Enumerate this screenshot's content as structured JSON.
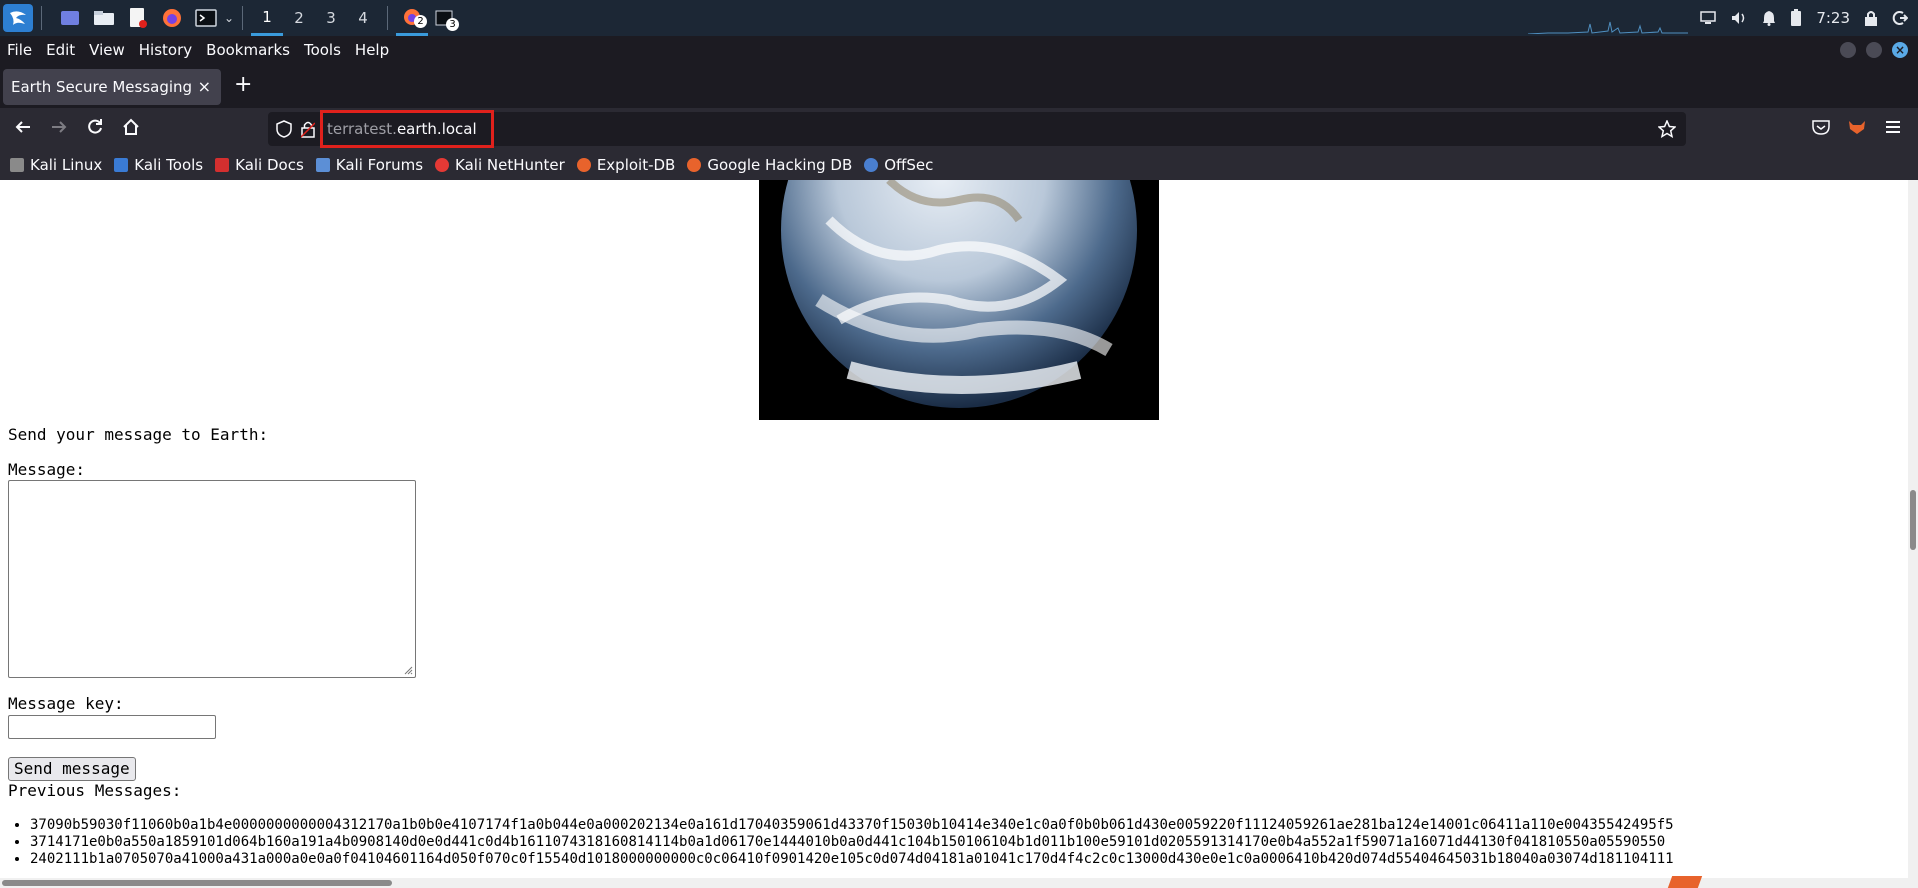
{
  "panel": {
    "workspaces": [
      "1",
      "2",
      "3",
      "4"
    ],
    "active_workspace": "1",
    "firefox_badge": "2",
    "terminal_badge": "3",
    "clock": "7:23"
  },
  "browser": {
    "menu": [
      "File",
      "Edit",
      "View",
      "History",
      "Bookmarks",
      "Tools",
      "Help"
    ],
    "tab_title": "Earth Secure Messaging",
    "tab_close": "×",
    "new_tab": "+",
    "url_subdomain": "terratest.",
    "url_domain": "earth.local",
    "bookmarks": [
      "Kali Linux",
      "Kali Tools",
      "Kali Docs",
      "Kali Forums",
      "Kali NetHunter",
      "Exploit-DB",
      "Google Hacking DB",
      "OffSec"
    ]
  },
  "page": {
    "heading": "Send your message to Earth:",
    "message_label": "Message:",
    "message_value": "",
    "key_label": "Message key:",
    "key_value": "",
    "send_button": "Send message",
    "previous_label": "Previous Messages:",
    "previous_messages": [
      "37090b59030f11060b0a1b4e0000000000004312170a1b0b0e4107174f1a0b044e0a000202134e0a161d17040359061d43370f15030b10414e340e1c0a0f0b0b061d430e0059220f11124059261ae281ba124e14001c06411a110e00435542495f5",
      "3714171e0b0a550a1859101d064b160a191a4b0908140d0e0d441c0d4b1611074318160814114b0a1d06170e1444010b0a0d441c104b150106104b1d011b100e59101d0205591314170e0b4a552a1f59071a16071d44130f041810550a05590550",
      "2402111b1a0705070a41000a431a000a0e0a0f04104601164d050f070c0f15540d1018000000000c0c06410f0901420e105c0d074d04181a01041c170d4f4c2c0c13000d430e0e1c0a0006410b420d074d55404645031b18040a03074d181104111"
    ]
  },
  "colors": {
    "panel_bg": "#1c2735",
    "browser_dark": "#1c1b22",
    "toolbar": "#2b2a33",
    "url_highlight": "#e0211c"
  }
}
